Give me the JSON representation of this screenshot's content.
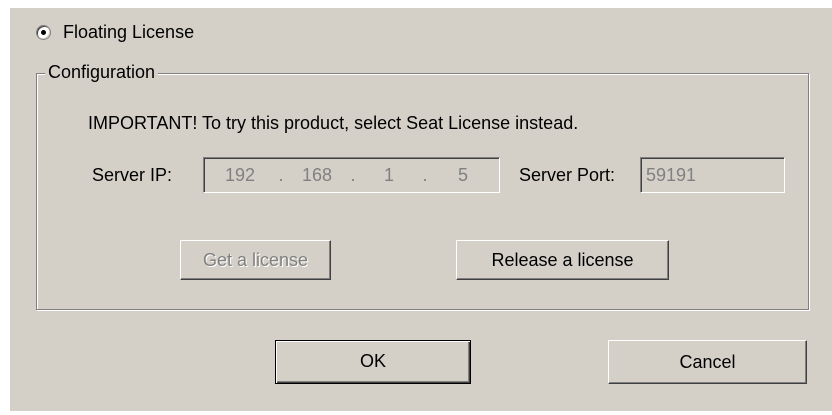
{
  "license_type": {
    "option_label": "Floating License",
    "selected": true
  },
  "configuration": {
    "group_label": "Configuration",
    "notice": "IMPORTANT! To try this product, select Seat License instead.",
    "server_ip_label": "Server IP:",
    "server_ip": {
      "octet1": "192",
      "octet2": "168",
      "octet3": "1",
      "octet4": "5",
      "separator": "."
    },
    "server_port_label": "Server Port:",
    "server_port": "59191",
    "get_license_label": "Get a license",
    "release_license_label": "Release a license"
  },
  "footer": {
    "ok_label": "OK",
    "cancel_label": "Cancel"
  },
  "colors": {
    "dialog_bg": "#d4d0c8",
    "disabled_text": "#808080"
  }
}
